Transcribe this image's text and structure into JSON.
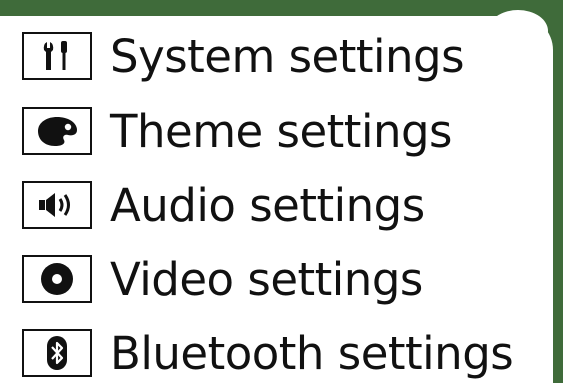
{
  "menu": {
    "items": [
      {
        "label": "System settings",
        "icon": "tools-icon"
      },
      {
        "label": "Theme settings",
        "icon": "palette-icon"
      },
      {
        "label": "Audio settings",
        "icon": "speaker-icon"
      },
      {
        "label": "Video settings",
        "icon": "disc-icon"
      },
      {
        "label": "Bluetooth settings",
        "icon": "bluetooth-icon"
      }
    ]
  },
  "colors": {
    "background": "#3f6b3a",
    "panel": "#ffffff",
    "text": "#111111"
  }
}
